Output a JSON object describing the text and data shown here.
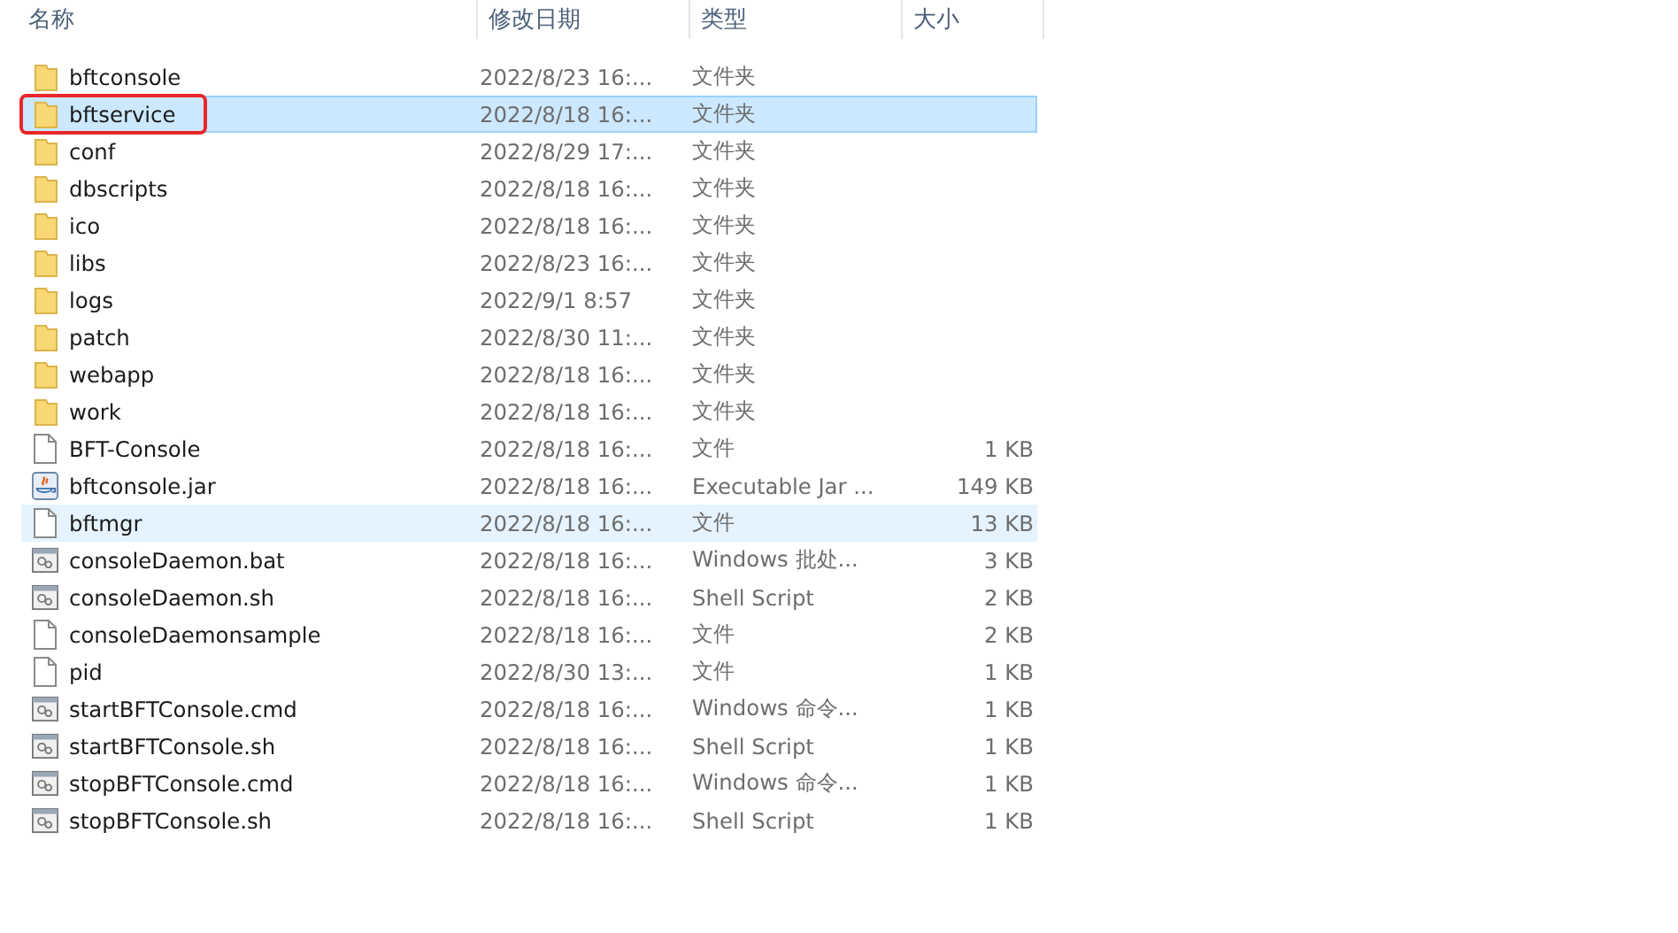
{
  "columns": [
    {
      "label": "名称"
    },
    {
      "label": "修改日期"
    },
    {
      "label": "类型"
    },
    {
      "label": "大小"
    }
  ],
  "files": [
    {
      "name": "bftconsole",
      "date": "2022/8/23 16:...",
      "type": "文件夹",
      "kind": "folder",
      "selected": false,
      "hovered": false,
      "annotated": false
    },
    {
      "name": "bftservice",
      "date": "2022/8/18 16:...",
      "type": "文件夹",
      "kind": "folder",
      "selected": true,
      "hovered": false,
      "annotated": true
    },
    {
      "name": "conf",
      "date": "2022/8/29 17:...",
      "type": "文件夹",
      "kind": "folder",
      "selected": false,
      "hovered": false,
      "annotated": false
    },
    {
      "name": "dbscripts",
      "date": "2022/8/18 16:...",
      "type": "文件夹",
      "kind": "folder",
      "selected": false,
      "hovered": false,
      "annotated": false
    },
    {
      "name": "ico",
      "date": "2022/8/18 16:...",
      "type": "文件夹",
      "kind": "folder",
      "selected": false,
      "hovered": false,
      "annotated": false
    },
    {
      "name": "libs",
      "date": "2022/8/23 16:...",
      "type": "文件夹",
      "kind": "folder",
      "selected": false,
      "hovered": false,
      "annotated": false
    },
    {
      "name": "logs",
      "date": "2022/9/1 8:57",
      "type": "文件夹",
      "kind": "folder",
      "selected": false,
      "hovered": false,
      "annotated": false
    },
    {
      "name": "patch",
      "date": "2022/8/30 11:...",
      "type": "文件夹",
      "kind": "folder",
      "selected": false,
      "hovered": false,
      "annotated": false
    },
    {
      "name": "webapp",
      "date": "2022/8/18 16:...",
      "type": "文件夹",
      "kind": "folder",
      "selected": false,
      "hovered": false,
      "annotated": false
    },
    {
      "name": "work",
      "date": "2022/8/18 16:...",
      "type": "文件夹",
      "kind": "folder",
      "selected": false,
      "hovered": false,
      "annotated": false
    },
    {
      "name": "BFT-Console",
      "date": "2022/8/18 16:...",
      "type": "文件",
      "size": "1 KB",
      "kind": "file",
      "selected": false,
      "hovered": false,
      "annotated": false
    },
    {
      "name": "bftconsole.jar",
      "date": "2022/8/18 16:...",
      "type": "Executable Jar ...",
      "size": "149 KB",
      "kind": "jar",
      "selected": false,
      "hovered": false,
      "annotated": false
    },
    {
      "name": "bftmgr",
      "date": "2022/8/18 16:...",
      "type": "文件",
      "size": "13 KB",
      "kind": "file",
      "selected": false,
      "hovered": true,
      "annotated": false
    },
    {
      "name": "consoleDaemon.bat",
      "date": "2022/8/18 16:...",
      "type": "Windows 批处...",
      "size": "3 KB",
      "kind": "script",
      "selected": false,
      "hovered": false,
      "annotated": false
    },
    {
      "name": "consoleDaemon.sh",
      "date": "2022/8/18 16:...",
      "type": "Shell Script",
      "size": "2 KB",
      "kind": "script",
      "selected": false,
      "hovered": false,
      "annotated": false
    },
    {
      "name": "consoleDaemonsample",
      "date": "2022/8/18 16:...",
      "type": "文件",
      "size": "2 KB",
      "kind": "file",
      "selected": false,
      "hovered": false,
      "annotated": false
    },
    {
      "name": "pid",
      "date": "2022/8/30 13:...",
      "type": "文件",
      "size": "1 KB",
      "kind": "file",
      "selected": false,
      "hovered": false,
      "annotated": false
    },
    {
      "name": "startBFTConsole.cmd",
      "date": "2022/8/18 16:...",
      "type": "Windows 命令...",
      "size": "1 KB",
      "kind": "script",
      "selected": false,
      "hovered": false,
      "annotated": false
    },
    {
      "name": "startBFTConsole.sh",
      "date": "2022/8/18 16:...",
      "type": "Shell Script",
      "size": "1 KB",
      "kind": "script",
      "selected": false,
      "hovered": false,
      "annotated": false
    },
    {
      "name": "stopBFTConsole.cmd",
      "date": "2022/8/18 16:...",
      "type": "Windows 命令...",
      "size": "1 KB",
      "kind": "script",
      "selected": false,
      "hovered": false,
      "annotated": false
    },
    {
      "name": "stopBFTConsole.sh",
      "date": "2022/8/18 16:...",
      "type": "Shell Script",
      "size": "1 KB",
      "kind": "script",
      "selected": false,
      "hovered": false,
      "annotated": false
    }
  ]
}
